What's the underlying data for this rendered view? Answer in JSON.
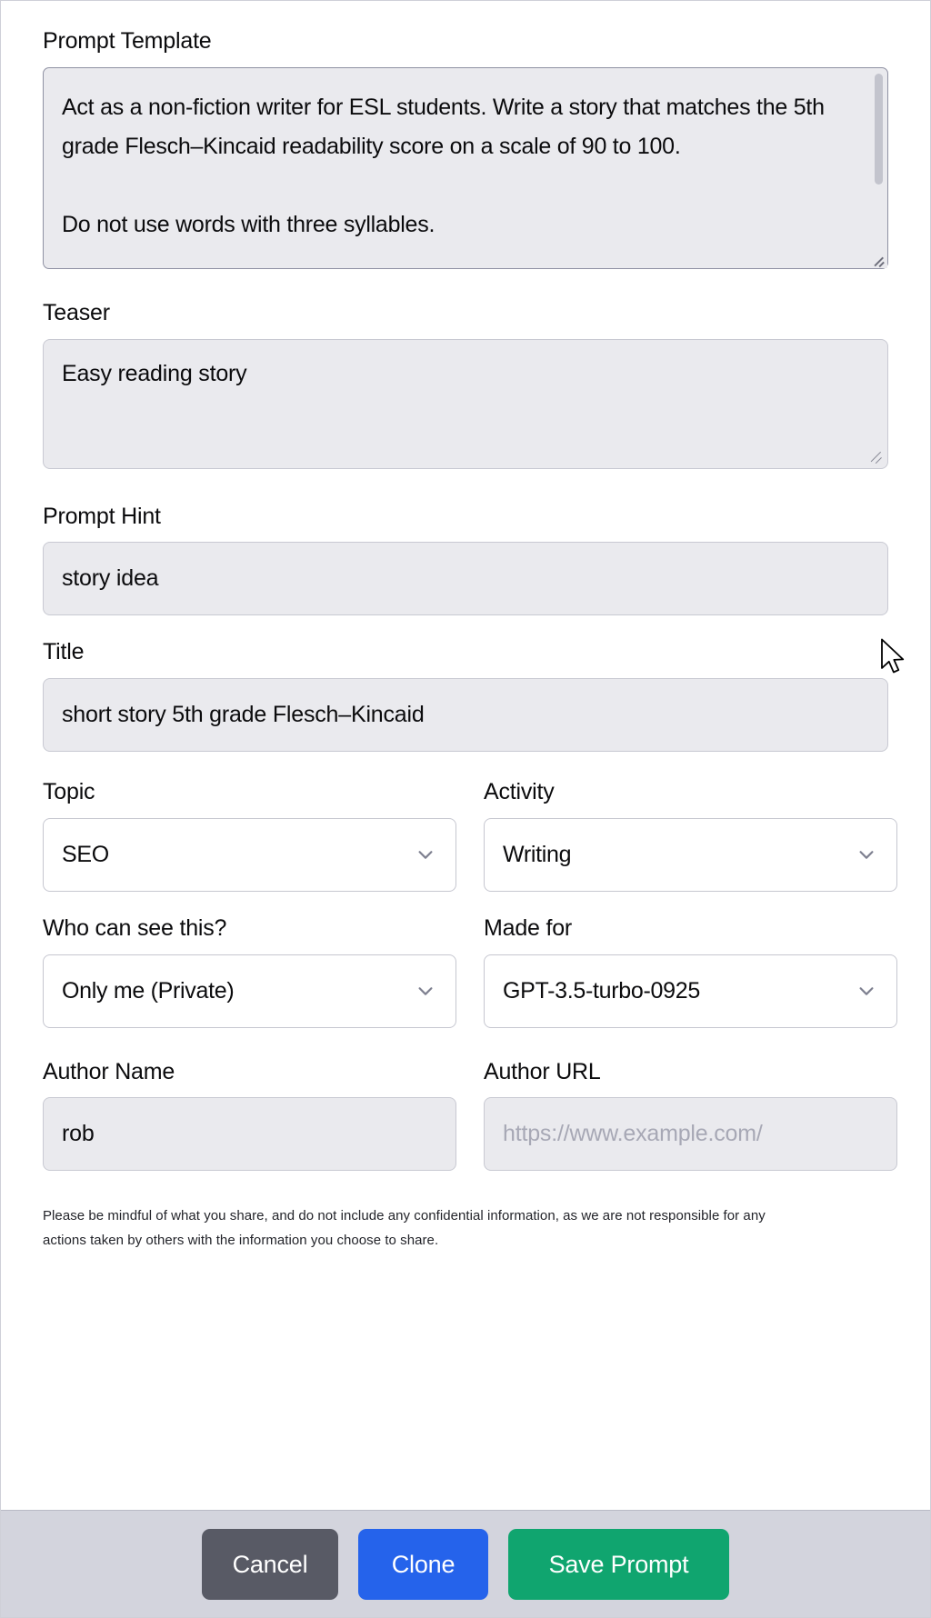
{
  "form": {
    "prompt_template": {
      "label": "Prompt Template",
      "value_line1": "Act as a non-fiction writer for ESL students. Write a story that",
      "value_line2": "matches the 5th grade Flesch–Kincaid readability score on a",
      "value_line3": "scale of 90 to 100.",
      "value_line4": "Do not use words with three syllables."
    },
    "teaser": {
      "label": "Teaser",
      "value": "Easy reading story"
    },
    "prompt_hint": {
      "label": "Prompt Hint",
      "value": "story idea"
    },
    "title": {
      "label": "Title",
      "value": "short story 5th grade Flesch–Kincaid"
    },
    "topic": {
      "label": "Topic",
      "value": "SEO"
    },
    "activity": {
      "label": "Activity",
      "value": "Writing"
    },
    "visibility": {
      "label": "Who can see this?",
      "value": "Only me (Private)"
    },
    "made_for": {
      "label": "Made for",
      "value": "GPT-3.5-turbo-0925"
    },
    "author_name": {
      "label": "Author Name",
      "value": "rob"
    },
    "author_url": {
      "label": "Author URL",
      "placeholder": "https://www.example.com/"
    },
    "disclaimer": "Please be mindful of what you share, and do not include any confidential information, as we are not responsible for any actions taken by others with the information you choose to share."
  },
  "footer": {
    "cancel_label": "Cancel",
    "clone_label": "Clone",
    "save_label": "Save Prompt"
  },
  "colors": {
    "cancel": "#585a65",
    "clone": "#2563eb",
    "save": "#10a56f",
    "field_fill": "#eaeaee",
    "footer_bg": "#d3d4dd"
  },
  "icons": {
    "chevron_down": "chevron-down-icon",
    "resize_handle": "resize-handle-icon",
    "mouse_pointer": "mouse-pointer-icon"
  }
}
